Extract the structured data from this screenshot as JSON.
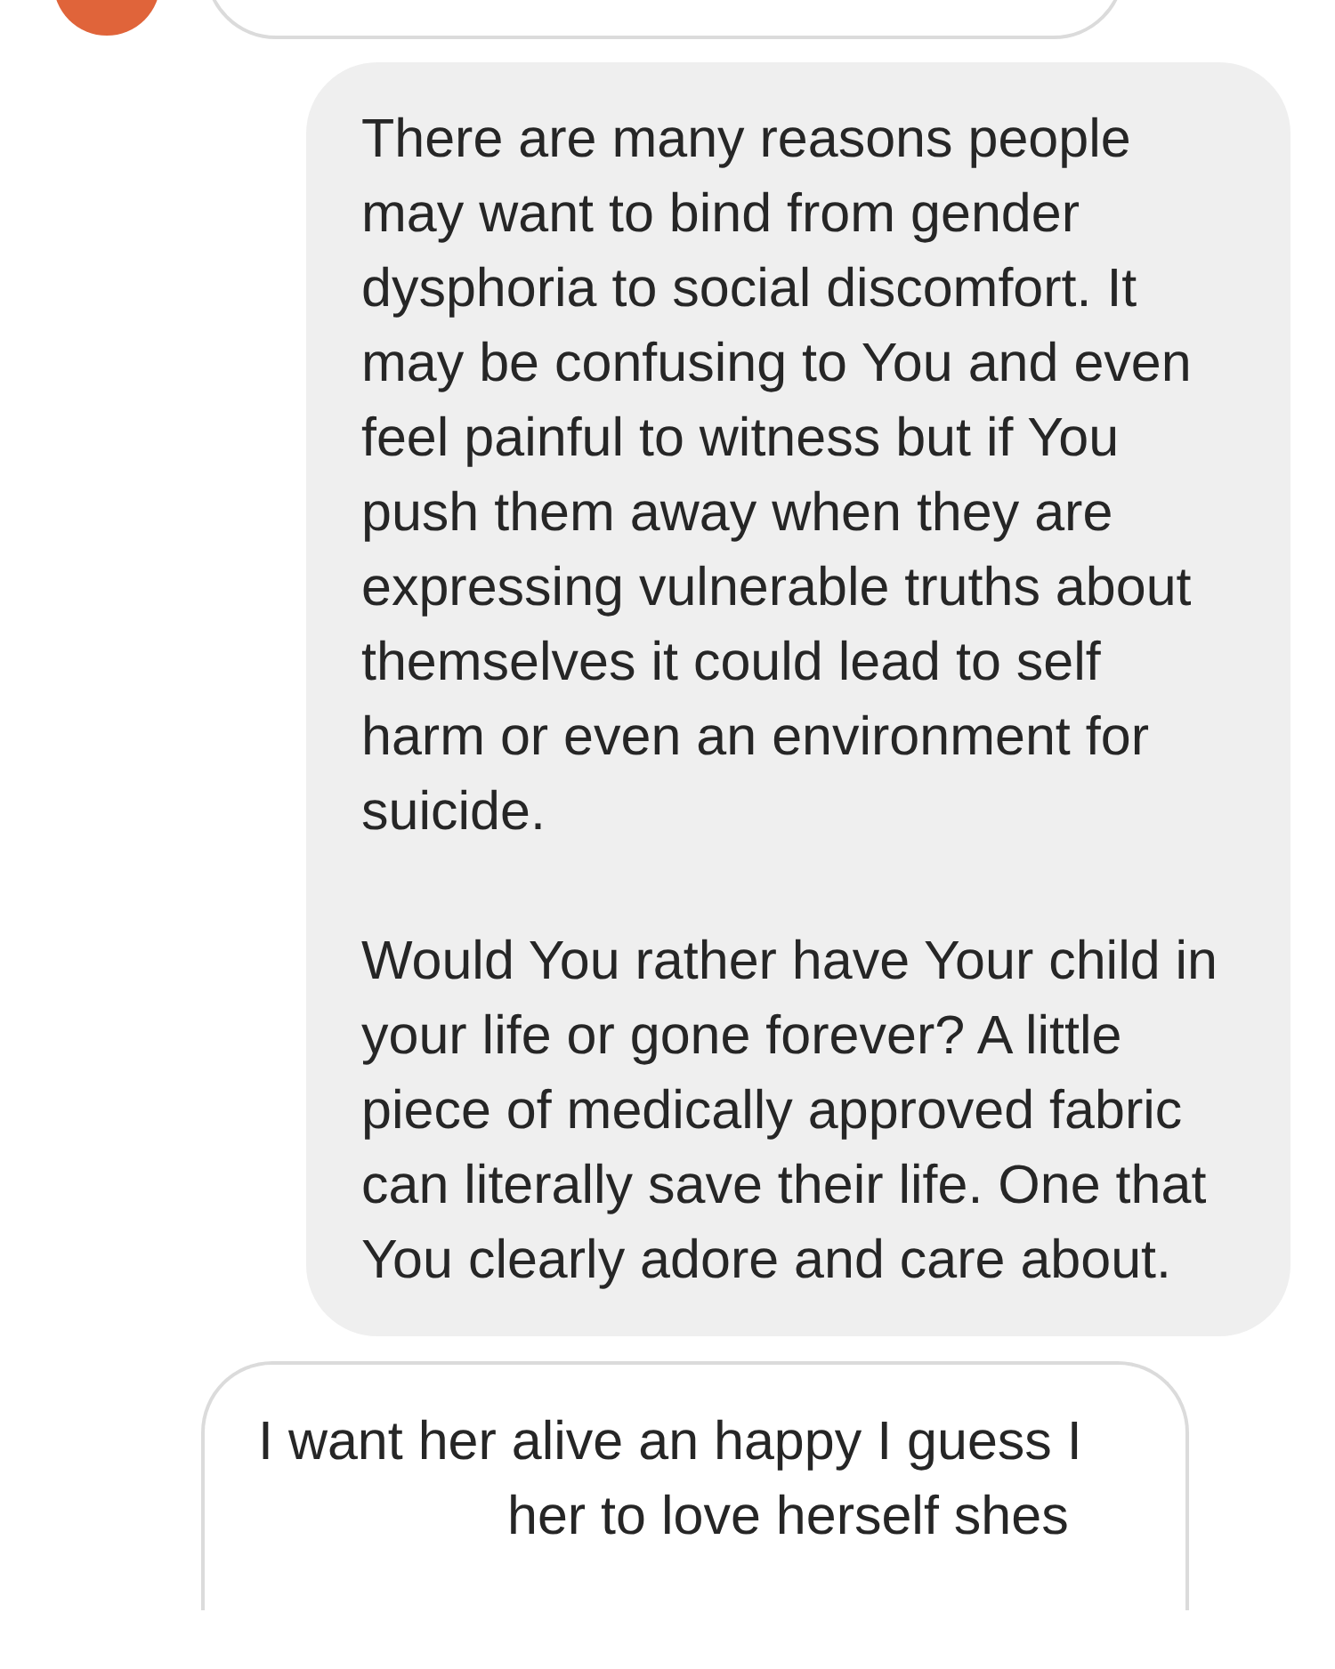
{
  "messages": [
    {
      "kind": "received",
      "avatar": true
    },
    {
      "kind": "sent",
      "avatar": false,
      "paragraphs": [
        "There are many reasons people may want to bind from gender dysphoria to social discomfort. It may be confusing to You and even feel painful to witness but if You push them away when they are expressing vulnerable truths about themselves it could lead to self harm or even an environment for suicide.",
        "Would You rather have Your child in your life or gone forever? A little piece of medically approved fabric can literally save their life. One that You clearly adore and care about."
      ]
    },
    {
      "kind": "received",
      "avatar": false,
      "paragraphs": [
        "I want her alive an happy I guess I",
        "her to love herself shes"
      ]
    }
  ]
}
